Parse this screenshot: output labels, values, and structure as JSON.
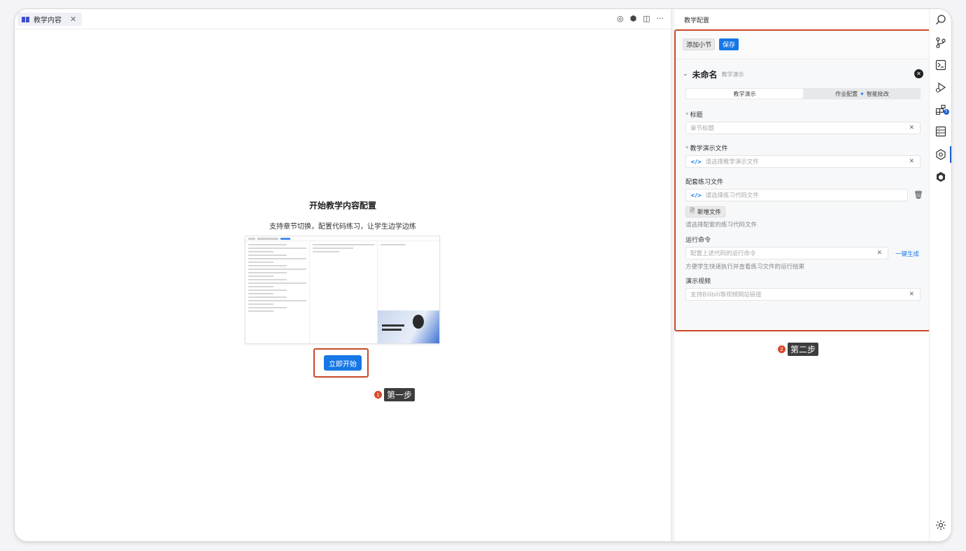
{
  "editor": {
    "tab_label": "教学内容",
    "tab_close": "✕",
    "actions": [
      "◎",
      "⬢",
      "◫",
      "···"
    ]
  },
  "welcome": {
    "title": "开始教学内容配置",
    "subtitle": "支持章节切换，配置代码练习，让学生边学边练",
    "start_button": "立即开始"
  },
  "steps": {
    "step1": {
      "number": "1",
      "label": "第一步"
    },
    "step2": {
      "number": "2",
      "label": "第二步"
    }
  },
  "panel": {
    "title": "教学配置",
    "toolbar": {
      "add_label": "添加小节",
      "save_label": "保存"
    },
    "section": {
      "name": "未命名",
      "type": "教学演示",
      "tabs": [
        {
          "label": "教学演示",
          "active": true
        },
        {
          "label": "作业配置",
          "extra": "智能批改",
          "active": false
        }
      ],
      "fields": {
        "title": {
          "label": "标题",
          "required": true,
          "placeholder": "章节标题"
        },
        "demo_file": {
          "label": "教学演示文件",
          "required": true,
          "placeholder": "请选择教学演示文件"
        },
        "practice_file": {
          "label": "配套练习文件",
          "placeholder": "请选择练习代码文件",
          "add_button": "新增文件",
          "hint": "请选择配套的练习代码文件"
        },
        "run_command": {
          "label": "运行命令",
          "placeholder": "配置上述代码的运行命令",
          "generate": "一键生成",
          "hint": "方便学生快速执行并查看练习文件的运行结果"
        },
        "video": {
          "label": "演示视频",
          "placeholder": "支持Bilibili等视频网站链接"
        }
      }
    }
  },
  "activity_bar": {
    "icons": [
      "search-icon",
      "source-control-icon",
      "terminal-icon",
      "run-debug-icon",
      "extensions-icon",
      "list-icon",
      "settings-hex-icon",
      "brand-icon",
      "gear-icon"
    ],
    "extensions_badge": "5"
  },
  "colors": {
    "accent": "#1677e6",
    "highlight_border": "#c94a2a",
    "step_dot": "#d9492a"
  }
}
